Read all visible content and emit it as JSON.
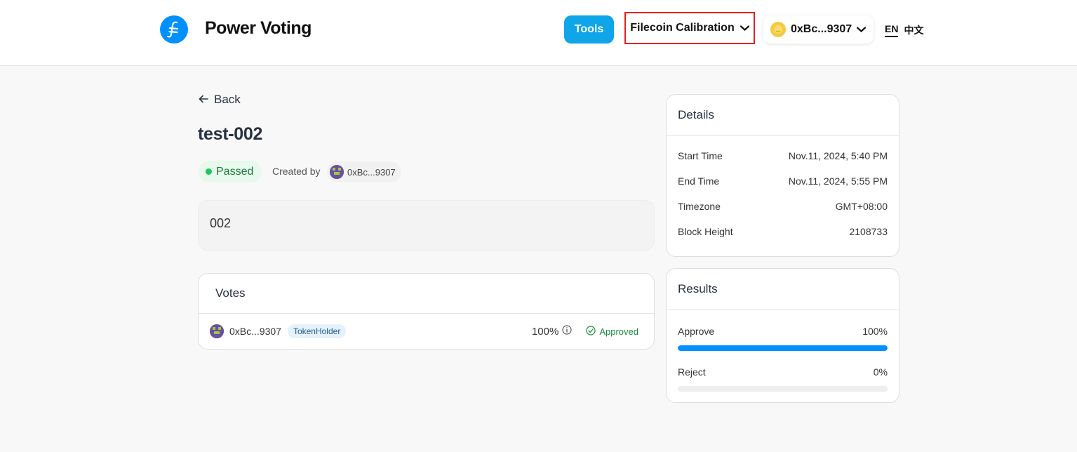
{
  "header": {
    "brand": "Power Voting",
    "tools_label": "Tools",
    "network_label": "Filecoin Calibration",
    "wallet_address": "0xBc...9307",
    "lang_en": "EN",
    "lang_zh": "中文"
  },
  "proposal": {
    "back_label": "Back",
    "title": "test-002",
    "status": "Passed",
    "created_by_label": "Created by",
    "creator": "0xBc...9307",
    "description": "002"
  },
  "votes": {
    "heading": "Votes",
    "rows": [
      {
        "address": "0xBc...9307",
        "role": "TokenHolder",
        "percent": "100%",
        "status": "Approved"
      }
    ]
  },
  "details": {
    "heading": "Details",
    "rows": [
      {
        "label": "Start Time",
        "value": "Nov.11, 2024, 5:40 PM"
      },
      {
        "label": "End Time",
        "value": "Nov.11, 2024, 5:55 PM"
      },
      {
        "label": "Timezone",
        "value": "GMT+08:00"
      },
      {
        "label": "Block Height",
        "value": "2108733"
      }
    ]
  },
  "results": {
    "heading": "Results",
    "items": [
      {
        "label": "Approve",
        "percent": "100%",
        "fraction": 1.0
      },
      {
        "label": "Reject",
        "percent": "0%",
        "fraction": 0.0
      }
    ]
  },
  "colors": {
    "accent": "#0090ff",
    "tools_button": "#0ea5e9",
    "highlight_border": "#e02020",
    "passed_green": "#22c55e"
  },
  "icons": [
    "filecoin-logo-icon",
    "chevron-down-icon",
    "wallet-avatar-icon",
    "arrow-left-icon",
    "user-avatar-icon",
    "info-icon",
    "check-circle-icon"
  ]
}
